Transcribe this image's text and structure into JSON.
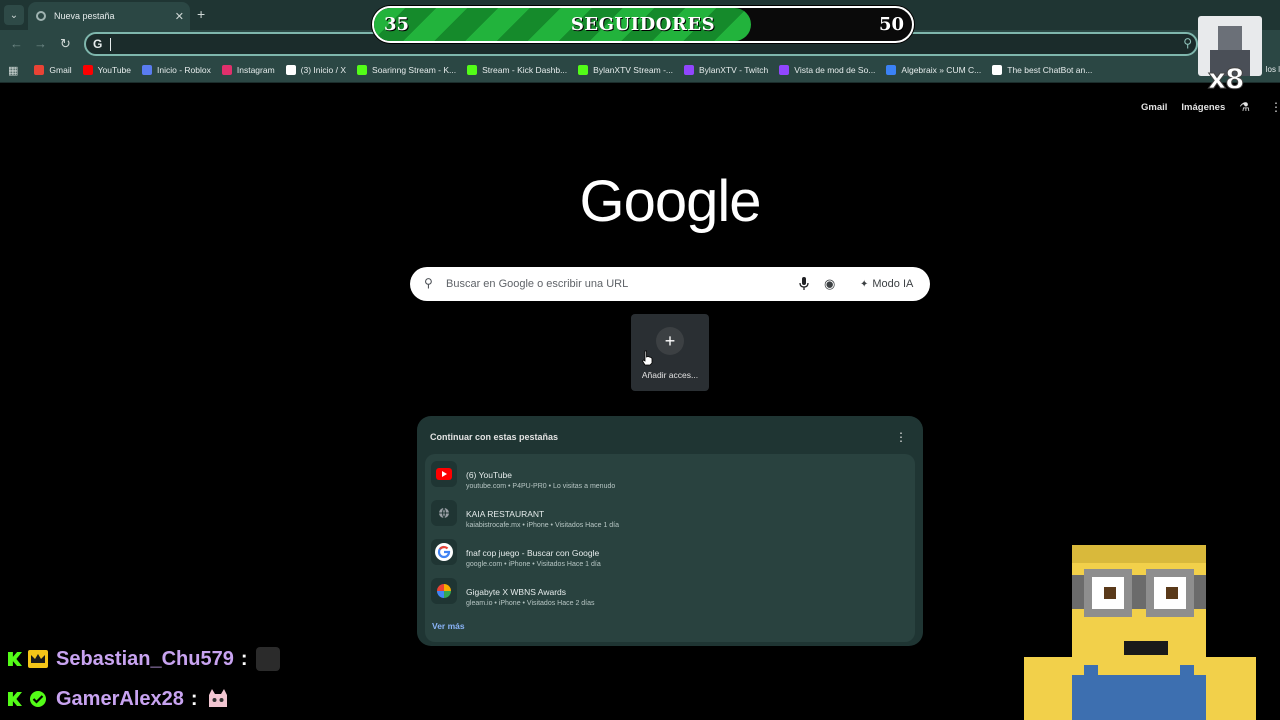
{
  "browser": {
    "tab_title": "Nueva pestaña",
    "omnibox_icon": "G",
    "bookmarks": [
      {
        "label": "Gmail",
        "icon": "gmail-icon",
        "color": "#ea4335"
      },
      {
        "label": "YouTube",
        "icon": "youtube-icon",
        "color": "#ff0000"
      },
      {
        "label": "Inicio - Roblox",
        "icon": "roblox-icon",
        "color": "#5a7cf0"
      },
      {
        "label": "Instagram",
        "icon": "instagram-icon",
        "color": "#e1306c"
      },
      {
        "label": "(3) Inicio / X",
        "icon": "x-icon",
        "color": "#ffffff"
      },
      {
        "label": "Soarinng Stream - K...",
        "icon": "kick-icon",
        "color": "#53fc18"
      },
      {
        "label": "Stream - Kick Dashb...",
        "icon": "kick-icon",
        "color": "#53fc18"
      },
      {
        "label": "BylanXTV Stream -...",
        "icon": "kick-icon",
        "color": "#53fc18"
      },
      {
        "label": "BylanXTV - Twitch",
        "icon": "twitch-icon",
        "color": "#9146ff"
      },
      {
        "label": "Vista de mod de So...",
        "icon": "twitch-icon",
        "color": "#9146ff"
      },
      {
        "label": "Algebraix » CUM C...",
        "icon": "algebraix-icon",
        "color": "#3b82f6"
      },
      {
        "label": "The best ChatBot an...",
        "icon": "chatbot-icon",
        "color": "#ffffff"
      }
    ],
    "bookmarks_overflow": "los l"
  },
  "followers": {
    "current": "35",
    "label": "SEGUIDORES",
    "goal": "50",
    "progress": 0.7
  },
  "multiplier": "x8",
  "google": {
    "top_links": {
      "gmail": "Gmail",
      "images": "Imágenes"
    },
    "logo": "Google",
    "search_placeholder": "Buscar en Google o escribir una URL",
    "ai_mode": "Modo IA",
    "add_shortcut": "Añadir acces..."
  },
  "continue_tabs": {
    "title": "Continuar con estas pestañas",
    "items": [
      {
        "title": "(6) YouTube",
        "subtitle": "youtube.com • P4PU-PR0 • Lo visitas a menudo",
        "icon": "youtube-icon"
      },
      {
        "title": "KAIA RESTAURANT",
        "subtitle": "kaiabistrocafe.mx • iPhone • Visitados Hace 1 día",
        "icon": "globe-icon"
      },
      {
        "title": "fnaf cop juego - Buscar con Google",
        "subtitle": "google.com • iPhone • Visitados Hace 1 día",
        "icon": "google-icon"
      },
      {
        "title": "Gigabyte X WBNS Awards",
        "subtitle": "gleam.io • iPhone • Visitados Hace 2 días",
        "icon": "gleam-icon"
      }
    ],
    "more": "Ver más"
  },
  "chat": [
    {
      "user": "Sebastian_Chu579",
      "badge": "crown-badge-icon"
    },
    {
      "user": "GamerAlex28",
      "badge": "verified-badge-icon"
    }
  ],
  "colors": {
    "accent": "#7fb7ad",
    "progress_green": "#22b33c",
    "chat_username": "#c8a3f0",
    "kick_green": "#53fc18"
  }
}
